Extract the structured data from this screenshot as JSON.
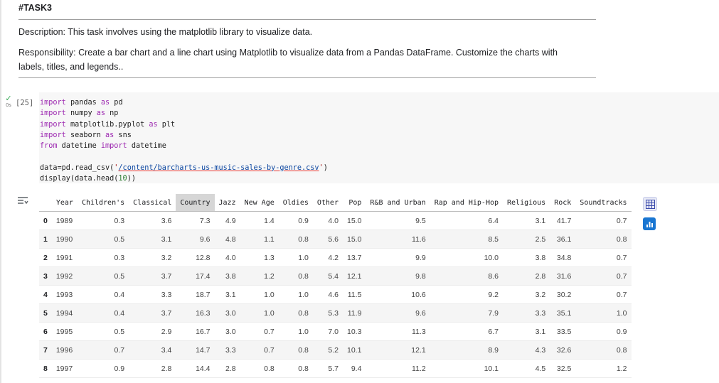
{
  "markdown": {
    "heading": "#TASK3",
    "description": "Description: This task involves using the matplotlib library to visualize data.",
    "responsibility": "Responsibility: Create a bar chart and a line chart using Matplotlib to visualize data from a Pandas DataFrame. Customize the charts with labels, titles, and legends.."
  },
  "cell": {
    "exec_count": "[25]",
    "exec_time": "0s",
    "code": {
      "l1": {
        "kw": "import",
        "mod": " pandas ",
        "as": "as",
        "alias": " pd"
      },
      "l2": {
        "kw": "import",
        "mod": " numpy ",
        "as": "as",
        "alias": " np"
      },
      "l3": {
        "kw": "import",
        "mod": " matplotlib.pyplot ",
        "as": "as",
        "alias": " plt"
      },
      "l4": {
        "kw": "import",
        "mod": " seaborn ",
        "as": "as",
        "alias": " sns"
      },
      "l5": {
        "kw": "from",
        "mod": " datetime ",
        "imp": "import",
        "name": " datetime"
      },
      "l6": {
        "pre": "data=pd.read_csv(",
        "q1": "'",
        "path": "/content/barcharts-us-music-sales-by-genre.csv",
        "q2": "'",
        "post": ")"
      },
      "l7": {
        "pre": "display(data.head(",
        "num": "10",
        "post": "))"
      }
    }
  },
  "dataframe": {
    "columns": [
      "",
      "Year",
      "Children's",
      "Classical",
      "Country",
      "Jazz",
      "New Age",
      "Oldies",
      "Other",
      "Pop",
      "R&B and Urban",
      "Rap and Hip-Hop",
      "Religious",
      "Rock",
      "Soundtracks"
    ],
    "highlighted_column": "Country",
    "rows": [
      [
        "0",
        "1989",
        "0.3",
        "3.6",
        "7.3",
        "4.9",
        "1.4",
        "0.9",
        "4.0",
        "15.0",
        "9.5",
        "6.4",
        "3.1",
        "41.7",
        "0.7"
      ],
      [
        "1",
        "1990",
        "0.5",
        "3.1",
        "9.6",
        "4.8",
        "1.1",
        "0.8",
        "5.6",
        "15.0",
        "11.6",
        "8.5",
        "2.5",
        "36.1",
        "0.8"
      ],
      [
        "2",
        "1991",
        "0.3",
        "3.2",
        "12.8",
        "4.0",
        "1.3",
        "1.0",
        "4.2",
        "13.7",
        "9.9",
        "10.0",
        "3.8",
        "34.8",
        "0.7"
      ],
      [
        "3",
        "1992",
        "0.5",
        "3.7",
        "17.4",
        "3.8",
        "1.2",
        "0.8",
        "5.4",
        "12.1",
        "9.8",
        "8.6",
        "2.8",
        "31.6",
        "0.7"
      ],
      [
        "4",
        "1993",
        "0.4",
        "3.3",
        "18.7",
        "3.1",
        "1.0",
        "1.0",
        "4.6",
        "11.5",
        "10.6",
        "9.2",
        "3.2",
        "30.2",
        "0.7"
      ],
      [
        "5",
        "1994",
        "0.4",
        "3.7",
        "16.3",
        "3.0",
        "1.0",
        "0.8",
        "5.3",
        "11.9",
        "9.6",
        "7.9",
        "3.3",
        "35.1",
        "1.0"
      ],
      [
        "6",
        "1995",
        "0.5",
        "2.9",
        "16.7",
        "3.0",
        "0.7",
        "1.0",
        "7.0",
        "10.3",
        "11.3",
        "6.7",
        "3.1",
        "33.5",
        "0.9"
      ],
      [
        "7",
        "1996",
        "0.7",
        "3.4",
        "14.7",
        "3.3",
        "0.7",
        "0.8",
        "5.2",
        "10.1",
        "12.1",
        "8.9",
        "4.3",
        "32.6",
        "0.8"
      ],
      [
        "8",
        "1997",
        "0.9",
        "2.8",
        "14.4",
        "2.8",
        "0.8",
        "0.8",
        "5.7",
        "9.4",
        "11.2",
        "10.1",
        "4.5",
        "32.5",
        "1.2"
      ]
    ]
  },
  "icons": {
    "output": "output-collapse-icon",
    "table": "table-icon",
    "chart": "bar-chart-icon",
    "check": "check-icon"
  },
  "colors": {
    "keyword": "#9c27b0",
    "string": "#a31515",
    "success": "#34a853",
    "chart_button": "#1976d2"
  }
}
